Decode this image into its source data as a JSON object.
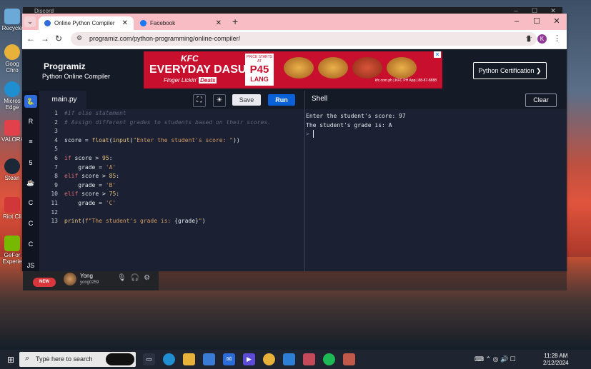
{
  "desktop": {
    "icons": [
      {
        "label": "Recycle",
        "color": "#6aa9d8"
      },
      {
        "label": "Goog Chro",
        "color": "#e8b13a"
      },
      {
        "label": "Micros Edge",
        "color": "#1f8fd2"
      },
      {
        "label": "VALORA",
        "color": "#e0414b"
      },
      {
        "label": "Stean",
        "color": "#1b2838"
      },
      {
        "label": "Riot Cli",
        "color": "#d13639"
      },
      {
        "label": "GeFor Experie",
        "color": "#76b900"
      }
    ]
  },
  "discord": {
    "title": "Discord",
    "new_badge": "NEW",
    "user_name": "Yong",
    "user_tag": "yong0259"
  },
  "browser": {
    "tabs": [
      {
        "title": "Online Python Compiler (Interp",
        "favicon_color": "#2f6bd9"
      },
      {
        "title": "Facebook",
        "favicon_color": "#1877f2"
      }
    ],
    "new_tab": "+",
    "url": "programiz.com/python-programming/online-compiler/",
    "profile_initial": "K"
  },
  "page": {
    "logo": "Programiz",
    "subtitle": "Python Online Compiler",
    "ad": {
      "brand": "KFC",
      "headline": "EVERYDAY DASURV",
      "slogan": "Finger Lickin'",
      "deals": "Deals",
      "price_small": "PRICE STARTS AT",
      "price": "P45",
      "price_unit": "LANG",
      "fine_print": "kfc.com.ph | KFC PH App | 88-87-8888"
    },
    "cert_button": "Python Certification ❯",
    "file_tab": "main.py",
    "save_label": "Save",
    "run_label": "Run",
    "shell_title": "Shell",
    "clear_label": "Clear",
    "accent_color": "#0b61d8"
  },
  "code_lines": [
    {
      "n": "1",
      "parts": [
        {
          "t": "#If else statement",
          "c": "c-comment"
        }
      ]
    },
    {
      "n": "2",
      "parts": [
        {
          "t": "# Assign different grades to students based on their scores.",
          "c": "c-comment"
        }
      ]
    },
    {
      "n": "3",
      "parts": []
    },
    {
      "n": "4",
      "parts": [
        {
          "t": "score = ",
          "c": "c-plain"
        },
        {
          "t": "float",
          "c": "c-fn"
        },
        {
          "t": "(",
          "c": "c-plain"
        },
        {
          "t": "input",
          "c": "c-fn"
        },
        {
          "t": "(",
          "c": "c-plain"
        },
        {
          "t": "\"Enter the student's score: \"",
          "c": "c-str"
        },
        {
          "t": "))",
          "c": "c-plain"
        }
      ]
    },
    {
      "n": "5",
      "parts": []
    },
    {
      "n": "6",
      "parts": [
        {
          "t": "if",
          "c": "c-kw"
        },
        {
          "t": " score > ",
          "c": "c-plain"
        },
        {
          "t": "95",
          "c": "c-num"
        },
        {
          "t": ":",
          "c": "c-plain"
        }
      ]
    },
    {
      "n": "7",
      "parts": [
        {
          "t": "    grade = ",
          "c": "c-plain"
        },
        {
          "t": "'A'",
          "c": "c-str"
        }
      ]
    },
    {
      "n": "8",
      "parts": [
        {
          "t": "elif",
          "c": "c-kw"
        },
        {
          "t": " score > ",
          "c": "c-plain"
        },
        {
          "t": "85",
          "c": "c-num"
        },
        {
          "t": ":",
          "c": "c-plain"
        }
      ]
    },
    {
      "n": "9",
      "parts": [
        {
          "t": "    grade = ",
          "c": "c-plain"
        },
        {
          "t": "'B'",
          "c": "c-str"
        }
      ]
    },
    {
      "n": "10",
      "parts": [
        {
          "t": "elif",
          "c": "c-kw"
        },
        {
          "t": " score > ",
          "c": "c-plain"
        },
        {
          "t": "75",
          "c": "c-num"
        },
        {
          "t": ":",
          "c": "c-plain"
        }
      ]
    },
    {
      "n": "11",
      "parts": [
        {
          "t": "    grade = ",
          "c": "c-plain"
        },
        {
          "t": "'C'",
          "c": "c-str"
        }
      ]
    },
    {
      "n": "12",
      "parts": []
    },
    {
      "n": "13",
      "parts": [
        {
          "t": "print",
          "c": "c-fn"
        },
        {
          "t": "(",
          "c": "c-plain"
        },
        {
          "t": "f\"The student's grade is: ",
          "c": "c-str"
        },
        {
          "t": "{grade}",
          "c": "c-plain"
        },
        {
          "t": "\"",
          "c": "c-str"
        },
        {
          "t": ")",
          "c": "c-plain"
        }
      ]
    }
  ],
  "shell_output": [
    "Enter the student's score: 97",
    "The student's grade is: A"
  ],
  "shell_prompt": ">",
  "taskbar": {
    "search_placeholder": "Type here to search",
    "time": "11:28 AM",
    "date": "2/12/2024"
  }
}
